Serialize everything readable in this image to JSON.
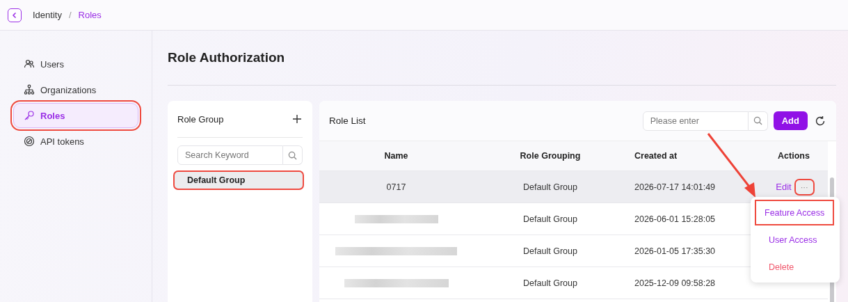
{
  "breadcrumb": [
    {
      "label": "Identity",
      "selected": false
    },
    {
      "separator": "/",
      "label": "Roles",
      "selected": true
    }
  ],
  "sidebar": {
    "items": [
      {
        "label": "Users",
        "selected": false,
        "highlighted": false
      },
      {
        "label": "Organizations",
        "selected": false,
        "highlighted": false
      },
      {
        "label": "Roles",
        "selected": true,
        "highlighted": true
      },
      {
        "label": "API tokens",
        "selected": false,
        "highlighted": false
      }
    ]
  },
  "page_title": "Role Authorization",
  "role_group": {
    "title": "Role Group",
    "search": {
      "placeholder": "Search Keyword"
    },
    "groups": [
      {
        "label": "Default Group",
        "selected": true,
        "highlighted": true
      }
    ]
  },
  "role_list": {
    "title": "Role List",
    "search": {
      "placeholder": "Please enter"
    },
    "add_button": "Add",
    "columns": [
      "Name",
      "Role Grouping",
      "Created at",
      "Actions"
    ],
    "rows": [
      {
        "name": "0717",
        "redacted": false,
        "group": "Default Group",
        "created": "2026-07-17 14:01:49",
        "edit": "Edit",
        "more": "···",
        "hovered": true
      },
      {
        "redacted": true,
        "group": "Default Group",
        "created": "2026-06-01 15:28:05",
        "hovered": false
      },
      {
        "redacted": true,
        "group": "Default Group",
        "created": "2026-01-05 17:35:30",
        "hovered": false
      },
      {
        "redacted": true,
        "group": "Default Group",
        "created": "2025-12-09 09:58:28",
        "hovered": false
      }
    ],
    "menu": [
      {
        "label": "Feature Access",
        "kind": "normal",
        "highlighted": true
      },
      {
        "label": "User Access",
        "kind": "normal",
        "highlighted": false
      },
      {
        "label": "Delete",
        "kind": "danger",
        "highlighted": false
      }
    ]
  }
}
